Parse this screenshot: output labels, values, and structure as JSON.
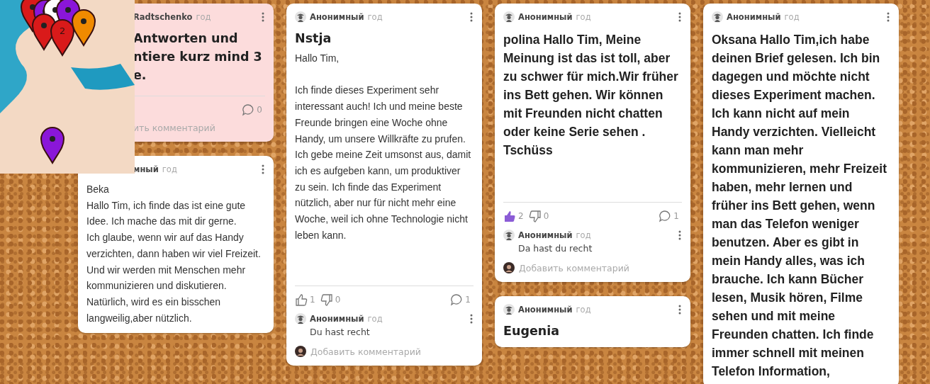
{
  "map": {
    "cluster_label": "2"
  },
  "columns": [
    {
      "cards": [
        {
          "kind": "partly_hidden",
          "color": "#fcdcdc",
          "author": "Radtschenko",
          "time": "год",
          "title": "Antworten und\nntiere kurz mind 3\ne.",
          "footer": {
            "comments_count": "0",
            "add_comment": "ить комментарий"
          }
        },
        {
          "kind": "partly_hidden",
          "color": "#ffffff",
          "author": "мный",
          "time": "год",
          "body": "Beka\nHallo Tim, ich finde das ist eine gute Idee. Ich mache das mit dir gerne.\nIch glaube, wenn wir auf das Handy verzichten, dann haben wir viel Freizeit. Und wir werden mit Menschen mehr kommunizieren und diskutieren.\nNatürlich, wird es ein bisschen langweilig,aber nützlich."
        }
      ]
    },
    {
      "cards": [
        {
          "kind": "post",
          "color": "#ffffff",
          "author": "Анонимный",
          "time": "год",
          "title": "Nstja",
          "body": "Hallo Tim,\n\nIch finde dieses Experiment sehr interessant auch! Ich und meine beste Freunde bringen eine Woche ohne Handy, um unsere Willkräfte zu prufen. Ich gebe meine Zeit umsonst aus, damit ich es aufgeben kann, um produktiver zu sein. Ich finde das Experiment nützlich, aber nur für nicht mehr eine Woche, weil ich ohne Technologie nicht leben kann.",
          "footer": {
            "liked": false,
            "likes": "1",
            "dislikes": "0",
            "comments_count": "1",
            "comments": [
              {
                "author": "Анонимный",
                "time": "год",
                "text": "Du hast recht"
              }
            ],
            "add_comment": "Добавить комментарий"
          }
        }
      ]
    },
    {
      "cards": [
        {
          "kind": "post",
          "color": "#ffffff",
          "author": "Анонимный",
          "time": "год",
          "big_body": "polina Hallo Tim, Meine Meinung ist das ist toll, aber zu schwer für mich.Wir früher ins Bett gehen. Wir können mit Freunden nicht chatten oder keine Serie sehen . Tschüss",
          "footer": {
            "liked": true,
            "likes": "2",
            "dislikes": "0",
            "comments_count": "1",
            "comments": [
              {
                "author": "Анонимный",
                "time": "год",
                "text": "Da hast du recht"
              }
            ],
            "add_comment": "Добавить комментарий"
          }
        },
        {
          "kind": "post",
          "color": "#ffffff",
          "author": "Анонимный",
          "time": "год",
          "title": "Eugenia"
        }
      ]
    },
    {
      "cards": [
        {
          "kind": "post",
          "color": "#ffffff",
          "author": "Анонимный",
          "time": "год",
          "big_body": "Oksana Hallo Tim,ich habe deinen Brief gelesen. Ich bin dagegen und möchte nicht dieses Experiment machen. Ich kann nicht auf mein Handy verzichten. Vielleicht kann man mehr kommunizieren, mehr Freizeit haben, mehr lernen und früher ins Bett gehen, wenn man das Telefon weniger benutzen. Aber es gibt in mein Handy alles, was ich brauche. Ich kann Bücher lesen, Musik hören, Filme sehen und mit meine Freunden chatten. Ich finde immer schnell mit meinen Telefon Information,"
        }
      ]
    }
  ]
}
